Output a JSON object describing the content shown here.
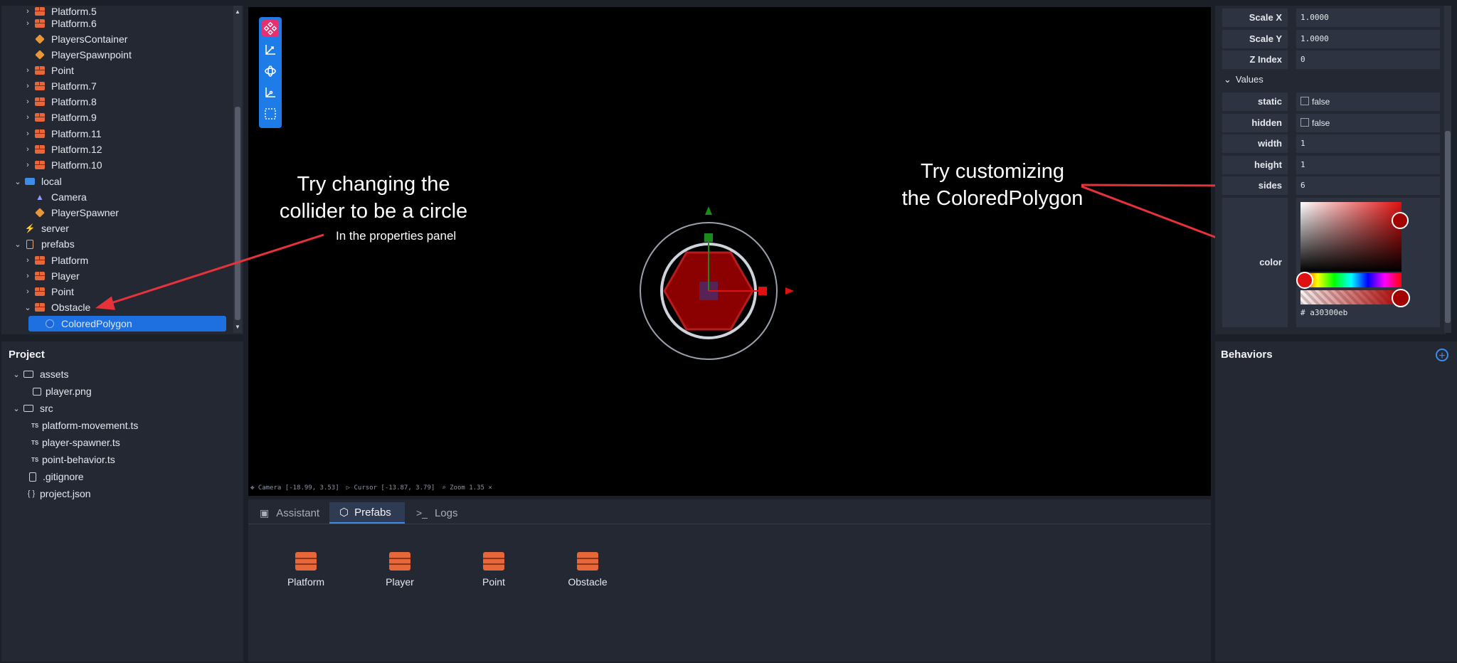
{
  "hierarchy": {
    "items": [
      {
        "label": "Platform.5",
        "icon": "brick-icon"
      },
      {
        "label": "Platform.6",
        "icon": "brick-icon"
      },
      {
        "label": "PlayersContainer",
        "icon": "cube-icon"
      },
      {
        "label": "PlayerSpawnpoint",
        "icon": "cube-icon"
      },
      {
        "label": "Point",
        "icon": "brick-icon"
      },
      {
        "label": "Platform.7",
        "icon": "brick-icon"
      },
      {
        "label": "Platform.8",
        "icon": "brick-icon"
      },
      {
        "label": "Platform.9",
        "icon": "brick-icon"
      },
      {
        "label": "Platform.11",
        "icon": "brick-icon"
      },
      {
        "label": "Platform.12",
        "icon": "brick-icon"
      },
      {
        "label": "Platform.10",
        "icon": "brick-icon"
      },
      {
        "label": "local",
        "icon": "laptop-icon"
      },
      {
        "label": "Camera",
        "icon": "camera-icon"
      },
      {
        "label": "PlayerSpawner",
        "icon": "cube-icon"
      },
      {
        "label": "server",
        "icon": "server-icon"
      },
      {
        "label": "prefabs",
        "icon": "file-icon"
      },
      {
        "label": "Platform",
        "icon": "brick-icon"
      },
      {
        "label": "Player",
        "icon": "brick-icon"
      },
      {
        "label": "Point",
        "icon": "brick-icon"
      },
      {
        "label": "Obstacle",
        "icon": "brick-icon"
      },
      {
        "label": "ColoredPolygon",
        "icon": "polygon-icon"
      }
    ]
  },
  "project": {
    "title": "Project",
    "files": [
      {
        "label": "assets",
        "icon": "folder-icon"
      },
      {
        "label": "player.png",
        "icon": "image-icon"
      },
      {
        "label": "src",
        "icon": "folder-icon"
      },
      {
        "label": "platform-movement.ts",
        "icon": "ts-icon"
      },
      {
        "label": "player-spawner.ts",
        "icon": "ts-icon"
      },
      {
        "label": "point-behavior.ts",
        "icon": "ts-icon"
      },
      {
        "label": ".gitignore",
        "icon": "file-icon"
      },
      {
        "label": "project.json",
        "icon": "json-icon"
      }
    ]
  },
  "viewport": {
    "status": {
      "camera": "Camera [-18.99, 3.53]",
      "cursor": "Cursor [-13.87, 3.79]",
      "zoom": "Zoom 1.35"
    },
    "annotation_left": {
      "line1": "Try changing the",
      "line2": "collider to be a circle",
      "sub": "In the properties panel"
    },
    "annotation_right": {
      "line1": "Try customizing",
      "line2": "the ColoredPolygon"
    }
  },
  "bottom_panel": {
    "tabs": [
      {
        "label": "Assistant",
        "icon": "robot-icon"
      },
      {
        "label": "Prefabs",
        "icon": "cube-icon"
      },
      {
        "label": "Logs",
        "icon": "terminal-icon"
      }
    ],
    "active_tab": "Prefabs",
    "prefabs": [
      "Platform",
      "Player",
      "Point",
      "Obstacle"
    ]
  },
  "properties": {
    "rows": [
      {
        "label": "Scale X",
        "value": "1.0000"
      },
      {
        "label": "Scale Y",
        "value": "1.0000"
      },
      {
        "label": "Z Index",
        "value": "0"
      }
    ],
    "values_section": "Values",
    "values": [
      {
        "label": "static",
        "value": "false"
      },
      {
        "label": "hidden",
        "value": "false"
      },
      {
        "label": "width",
        "value": "1"
      },
      {
        "label": "height",
        "value": "1"
      },
      {
        "label": "sides",
        "value": "6"
      }
    ],
    "color_label": "color",
    "color_hex": "# a30300eb"
  },
  "behaviors": {
    "title": "Behaviors"
  },
  "colors": {
    "accent": "#1e7ce8",
    "selection": "#1e6fe0",
    "polygon_fill": "#8b0000",
    "annotation_arrow": "#e8323a",
    "tool_active": "#e8306e"
  }
}
